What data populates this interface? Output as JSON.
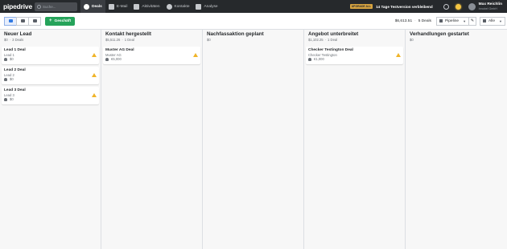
{
  "app": {
    "logo": "pipedrive",
    "search_placeholder": "Suche..."
  },
  "nav": [
    {
      "label": "Deals",
      "icon": "deals-icon",
      "active": true
    },
    {
      "label": "E-Mail",
      "icon": "mail-icon"
    },
    {
      "label": "Aktivitäten",
      "icon": "calendar-icon"
    },
    {
      "label": "Kontakte",
      "icon": "contacts-icon"
    },
    {
      "label": "Analyse",
      "icon": "chart-icon"
    }
  ],
  "topbar": {
    "badge": "UPGRADE ALL",
    "trial": "14 Tage Testversion verbleibend",
    "user_name": "Max Reichlin",
    "user_company": "Innobel GmbH"
  },
  "toolbar": {
    "add_label": "Geschäft",
    "total_value": "$6,613.51",
    "deal_count": "5 Deals",
    "pipeline_label": "Pipeline",
    "filter_label": "Alle"
  },
  "columns": [
    {
      "title": "Neuer Lead",
      "value": "$0",
      "count": "3 Deals",
      "cards": [
        {
          "title": "Lead 1 Deal",
          "org": "Lead 1",
          "amount": "$0"
        },
        {
          "title": "Lead 2 Deal",
          "org": "Lead 2",
          "amount": "$0"
        },
        {
          "title": "Lead 3 Deal",
          "org": "Lead 3",
          "amount": "$0"
        }
      ]
    },
    {
      "title": "Kontakt hergestellt",
      "value": "$5,511.26",
      "count": "1 Deal",
      "cards": [
        {
          "title": "Muster AG Deal",
          "org": "Muster AG",
          "amount": "€5,000"
        }
      ]
    },
    {
      "title": "Nachfassaktion geplant",
      "value": "$0",
      "count": "",
      "cards": []
    },
    {
      "title": "Angebot unterbreitet",
      "value": "$1,102.25",
      "count": "1 Deal",
      "cards": [
        {
          "title": "Checker Testington Deal",
          "org": "Checker Testington",
          "amount": "€1,000"
        }
      ]
    },
    {
      "title": "Verhandlungen gestartet",
      "value": "$0",
      "count": "",
      "cards": []
    }
  ],
  "colors": {
    "topbar": "#26292c",
    "accent_green": "#25a35a",
    "warning": "#f0b429",
    "active_blue": "#317ae2"
  }
}
